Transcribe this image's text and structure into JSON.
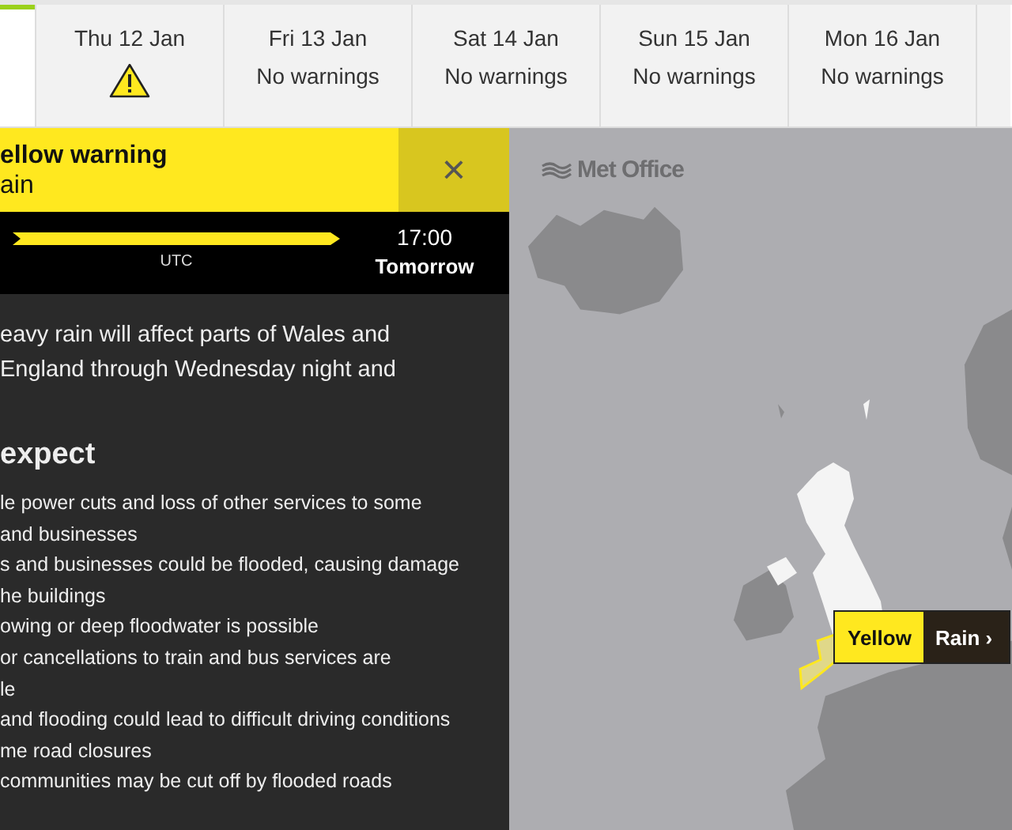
{
  "tabs": [
    {
      "selected": true
    },
    {
      "label": "Thu 12 Jan",
      "kind": "warning",
      "selected": false
    },
    {
      "label": "Fri 13 Jan",
      "kind": "text",
      "status": "No warnings",
      "selected": false
    },
    {
      "label": "Sat 14 Jan",
      "kind": "text",
      "status": "No warnings",
      "selected": false
    },
    {
      "label": "Sun 15 Jan",
      "kind": "text",
      "status": "No warnings",
      "selected": false
    },
    {
      "label": "Mon 16 Jan",
      "kind": "text",
      "status": "No warnings",
      "selected": false
    },
    {
      "selected": false
    }
  ],
  "warning": {
    "title": "ellow warning",
    "subtitle": "ain",
    "close": "×",
    "timeline": {
      "zone": "UTC",
      "time": "17:00",
      "day": "Tomorrow"
    },
    "summary": [
      "eavy rain will affect parts of Wales and",
      "England through Wednesday night and"
    ],
    "heading": "expect",
    "impacts": [
      "le power cuts and loss of other services to some",
      " and businesses",
      "s and businesses could be flooded, causing damage",
      "he buildings",
      "owing or deep floodwater is possible",
      " or cancellations to train and bus services are",
      "le",
      "and flooding could lead to difficult driving conditions",
      "me road closures",
      "communities may be cut off by flooded roads"
    ]
  },
  "map": {
    "logo": "Met Office",
    "marker": {
      "level": "Yellow",
      "type": "Rain",
      "arrow": "›",
      "color": "#ffe81f"
    }
  }
}
